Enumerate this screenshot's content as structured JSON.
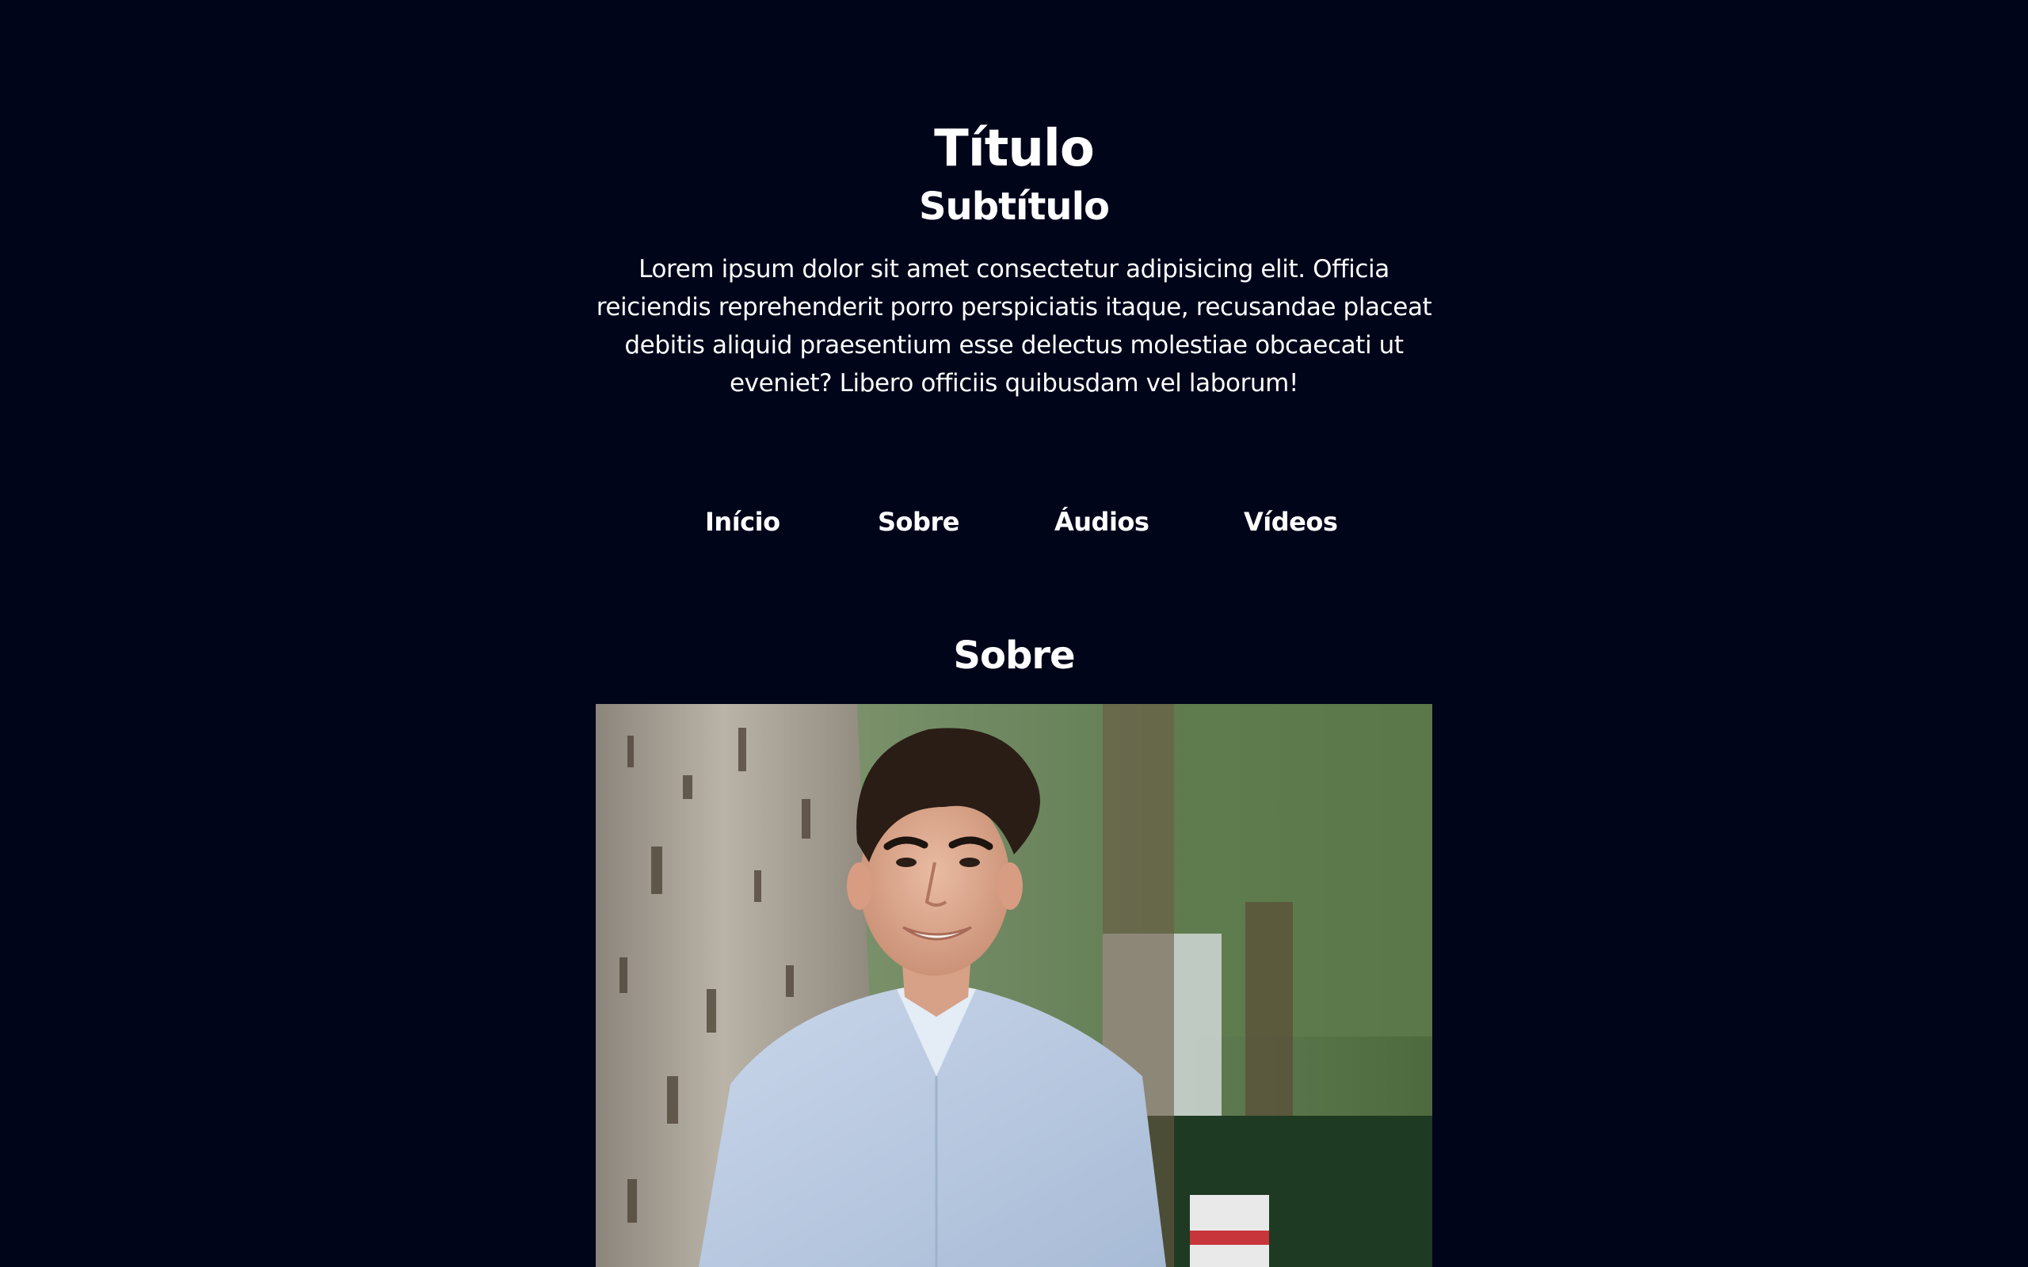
{
  "header": {
    "title": "Título",
    "subtitle": "Subtítulo",
    "intro": "Lorem ipsum dolor sit amet consectetur adipisicing elit. Officia reiciendis reprehenderit porro perspiciatis itaque, recusandae placeat debitis aliquid praesentium esse delectus molestiae obcaecati ut eveniet? Libero officiis quibusdam vel laborum!"
  },
  "nav": {
    "items": [
      {
        "label": "Início"
      },
      {
        "label": "Sobre"
      },
      {
        "label": "Áudios"
      },
      {
        "label": "Vídeos"
      }
    ]
  },
  "about": {
    "heading": "Sobre",
    "photo_icon": "portrait-photo"
  },
  "colors": {
    "background": "#01051a",
    "text": "#ffffff"
  }
}
